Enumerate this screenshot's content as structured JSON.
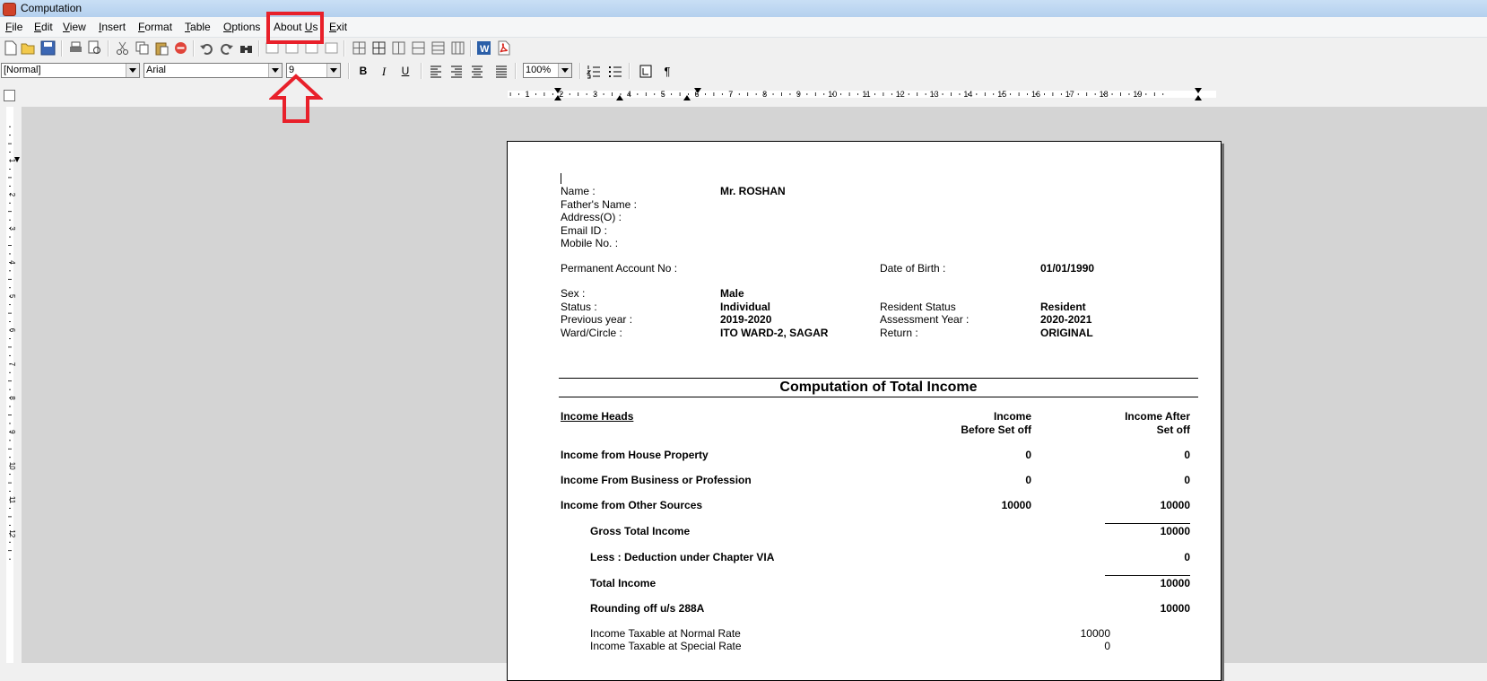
{
  "window": {
    "title": "Computation"
  },
  "menu": [
    "File",
    "Edit",
    "View",
    "Insert",
    "Format",
    "Table",
    "Options",
    "About Us",
    "Exit"
  ],
  "format_bar": {
    "style": "[Normal]",
    "font": "Arial",
    "size": "9",
    "zoom": "100%"
  },
  "ruler_numbers": [
    "1",
    "2",
    "3",
    "4",
    "5",
    "6",
    "7",
    "8",
    "9",
    "10",
    "11",
    "12",
    "13",
    "14",
    "15",
    "16",
    "17",
    "18",
    "19"
  ],
  "vruler_numbers": [
    "1",
    "2",
    "3",
    "4",
    "5",
    "6",
    "7",
    "8",
    "9",
    "10",
    "11",
    "12"
  ],
  "doc": {
    "name_label": "Name :",
    "name_value": "Mr. ROSHAN",
    "father_label": "Father's Name :",
    "address_label": "Address(O) :",
    "email_label": "Email ID :",
    "mobile_label": "Mobile No. :",
    "pan_label": "Permanent Account No :",
    "dob_label": "Date of Birth :",
    "dob_value": "01/01/1990",
    "sex_label": "Sex :",
    "sex_value": "Male",
    "status_label": "Status :",
    "status_value": "Individual",
    "resident_label": "Resident Status",
    "resident_value": "Resident",
    "prev_year_label": "Previous year :",
    "prev_year_value": "2019-2020",
    "ay_label": "Assessment Year :",
    "ay_value": "2020-2021",
    "ward_label": "Ward/Circle :",
    "ward_value": "ITO WARD-2, SAGAR",
    "return_label": "Return :",
    "return_value": "ORIGINAL",
    "heading": "Computation of Total Income",
    "col_heads": "Income Heads",
    "col_income_1": "Income",
    "col_income_2": "Before Set off",
    "col_after_1": "Income After",
    "col_after_2": "Set off",
    "rows": [
      {
        "label": "Income from House Property",
        "before": "0",
        "after": "0"
      },
      {
        "label": "Income From Business or Profession",
        "before": "0",
        "after": "0"
      },
      {
        "label": "Income from Other Sources",
        "before": "10000",
        "after": "10000"
      }
    ],
    "gross_label": "Gross Total Income",
    "gross_value": "10000",
    "deduction_label": "Less : Deduction under Chapter VIA",
    "deduction_value": "0",
    "total_label": "Total Income",
    "total_value": "10000",
    "rounding_label": "Rounding off u/s 288A",
    "rounding_value": "10000",
    "normal_rate_label": "Income Taxable at Normal Rate",
    "normal_rate_value": "10000",
    "special_rate_label": "Income Taxable at Special Rate",
    "special_rate_value": "0"
  },
  "colors": {
    "highlight": "#e8202a"
  }
}
